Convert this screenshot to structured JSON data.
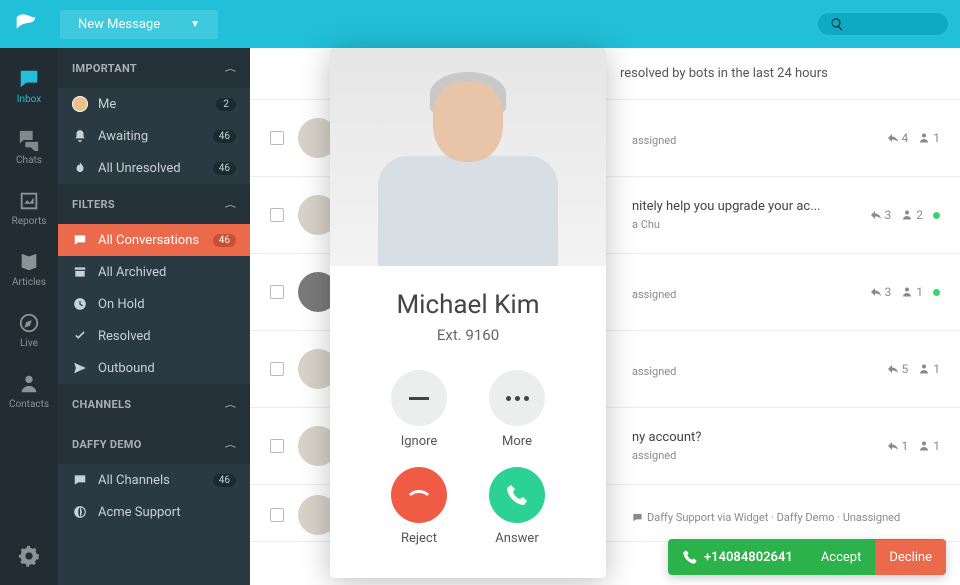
{
  "topbar": {
    "new_message": "New Message"
  },
  "rail": {
    "items": [
      {
        "label": "Inbox"
      },
      {
        "label": "Chats"
      },
      {
        "label": "Reports"
      },
      {
        "label": "Articles"
      },
      {
        "label": "Live"
      },
      {
        "label": "Contacts"
      }
    ]
  },
  "sidebar": {
    "sections": {
      "important": {
        "title": "IMPORTANT",
        "items": [
          {
            "label": "Me",
            "badge": "2"
          },
          {
            "label": "Awaiting",
            "badge": "46"
          },
          {
            "label": "All Unresolved",
            "badge": "46"
          }
        ]
      },
      "filters": {
        "title": "FILTERS",
        "items": [
          {
            "label": "All Conversations",
            "badge": "46"
          },
          {
            "label": "All Archived"
          },
          {
            "label": "On Hold"
          },
          {
            "label": "Resolved"
          },
          {
            "label": "Outbound"
          }
        ]
      },
      "channels": {
        "title": "CHANNELS"
      },
      "daffy": {
        "title": "DAFFY DEMO",
        "items": [
          {
            "label": "All Channels",
            "badge": "46"
          },
          {
            "label": "Acme Support"
          }
        ]
      }
    }
  },
  "banner": "resolved by bots in the last 24 hours",
  "rows": [
    {
      "subject": "",
      "assignee": "assigned",
      "replies": "4",
      "people": "1",
      "online": false
    },
    {
      "subject": "nitely help you upgrade your ac...",
      "assignee": "a Chu",
      "replies": "3",
      "people": "2",
      "online": true
    },
    {
      "subject": "",
      "assignee": "assigned",
      "replies": "3",
      "people": "1",
      "online": true
    },
    {
      "subject": "",
      "assignee": "assigned",
      "replies": "5",
      "people": "1",
      "online": false
    },
    {
      "subject": "ny account?",
      "assignee": "assigned",
      "replies": "1",
      "people": "1",
      "online": false
    }
  ],
  "footer_meta": "Daffy Support via Widget · Daffy Demo · Unassigned",
  "call": {
    "name": "Michael Kim",
    "ext": "Ext. 9160",
    "ignore": "Ignore",
    "more": "More",
    "reject": "Reject",
    "answer": "Answer"
  },
  "callbar": {
    "number": "+14084802641",
    "accept": "Accept",
    "decline": "Decline"
  }
}
